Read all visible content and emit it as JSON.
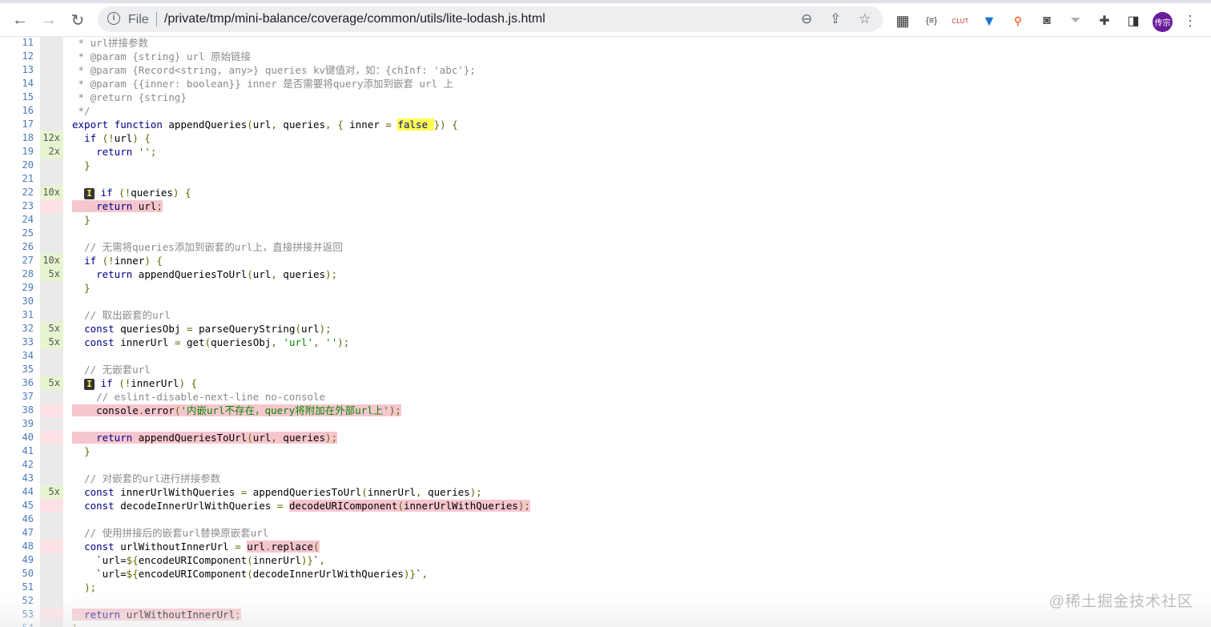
{
  "browser": {
    "scheme_label": "File",
    "url": "/private/tmp/mini-balance/coverage/common/utils/lite-lodash.js.html",
    "avatar_text": "传宗",
    "extensions": [
      "qr-code-icon",
      "json-viewer-icon",
      "clut-icon",
      "vue-devtools-icon",
      "sitemap-icon",
      "tampermonkey-icon",
      "filter-icon",
      "puzzle-icon",
      "side-panel-icon"
    ]
  },
  "watermark": "@稀土掘金技术社区",
  "lines": [
    {
      "n": "11",
      "hits": "",
      "cov": "neutral",
      "segs": [
        [
          "c",
          " * url拼接参数"
        ]
      ]
    },
    {
      "n": "12",
      "hits": "",
      "cov": "neutral",
      "segs": [
        [
          "c",
          " * @param {string} url 原始链接"
        ]
      ]
    },
    {
      "n": "13",
      "hits": "",
      "cov": "neutral",
      "segs": [
        [
          "c",
          " * @param {Record<string, any>} queries kv键值对，如：{chInf: 'abc'};"
        ]
      ]
    },
    {
      "n": "14",
      "hits": "",
      "cov": "neutral",
      "segs": [
        [
          "c",
          " * @param {{inner: boolean}} inner 是否需要将query添加到嵌套 url 上"
        ]
      ]
    },
    {
      "n": "15",
      "hits": "",
      "cov": "neutral",
      "segs": [
        [
          "c",
          " * @return {string}"
        ]
      ]
    },
    {
      "n": "16",
      "hits": "",
      "cov": "neutral",
      "segs": [
        [
          "c",
          " */"
        ]
      ]
    },
    {
      "n": "17",
      "hits": "",
      "cov": "neutral",
      "segs": [
        [
          "k",
          "export"
        ],
        [
          "p",
          " "
        ],
        [
          "k",
          "function"
        ],
        [
          "p",
          " appendQueries"
        ],
        [
          "n",
          "("
        ],
        [
          "p",
          "url"
        ],
        [
          "n",
          ","
        ],
        [
          "p",
          " queries"
        ],
        [
          "n",
          ","
        ],
        [
          "p",
          " "
        ],
        [
          "n",
          "{"
        ],
        [
          "p",
          " inner "
        ],
        [
          "n",
          "="
        ],
        [
          "p",
          " "
        ],
        [
          "k hl-yel",
          "false "
        ],
        [
          "n",
          "})"
        ],
        [
          "p",
          " "
        ],
        [
          "n",
          "{"
        ]
      ]
    },
    {
      "n": "18",
      "hits": "12x",
      "cov": "yes",
      "segs": [
        [
          "p",
          "  "
        ],
        [
          "k",
          "if"
        ],
        [
          "p",
          " "
        ],
        [
          "n",
          "(!"
        ],
        [
          "p",
          "url"
        ],
        [
          "n",
          ")"
        ],
        [
          "p",
          " "
        ],
        [
          "n",
          "{"
        ]
      ]
    },
    {
      "n": "19",
      "hits": "2x",
      "cov": "yes",
      "segs": [
        [
          "p",
          "    "
        ],
        [
          "k",
          "return"
        ],
        [
          "p",
          " "
        ],
        [
          "s",
          "''"
        ],
        [
          "n",
          ";"
        ]
      ]
    },
    {
      "n": "20",
      "hits": "",
      "cov": "neutral",
      "segs": [
        [
          "p",
          "  "
        ],
        [
          "n",
          "}"
        ]
      ]
    },
    {
      "n": "21",
      "hits": "",
      "cov": "neutral",
      "segs": []
    },
    {
      "n": "22",
      "hits": "10x",
      "cov": "yes",
      "segs": [
        [
          "p",
          "  "
        ],
        [
          "badge",
          "I"
        ],
        [
          "p",
          " "
        ],
        [
          "k",
          "if"
        ],
        [
          "p",
          " "
        ],
        [
          "n",
          "(!"
        ],
        [
          "p",
          "queries"
        ],
        [
          "n",
          ")"
        ],
        [
          "p",
          " "
        ],
        [
          "n",
          "{"
        ]
      ]
    },
    {
      "n": "23",
      "hits": "",
      "cov": "no",
      "segs": [
        [
          "k hl-no",
          "    return"
        ],
        [
          "p hl-no",
          " url"
        ],
        [
          "n hl-no",
          ";"
        ]
      ]
    },
    {
      "n": "24",
      "hits": "",
      "cov": "neutral",
      "segs": [
        [
          "p",
          "  "
        ],
        [
          "n",
          "}"
        ]
      ]
    },
    {
      "n": "25",
      "hits": "",
      "cov": "neutral",
      "segs": []
    },
    {
      "n": "26",
      "hits": "",
      "cov": "neutral",
      "segs": [
        [
          "p",
          "  "
        ],
        [
          "c",
          "// 无需将queries添加到嵌套的url上，直接拼接并返回"
        ]
      ]
    },
    {
      "n": "27",
      "hits": "10x",
      "cov": "yes",
      "segs": [
        [
          "p",
          "  "
        ],
        [
          "k",
          "if"
        ],
        [
          "p",
          " "
        ],
        [
          "n",
          "(!"
        ],
        [
          "p",
          "inner"
        ],
        [
          "n",
          ")"
        ],
        [
          "p",
          " "
        ],
        [
          "n",
          "{"
        ]
      ]
    },
    {
      "n": "28",
      "hits": "5x",
      "cov": "yes",
      "segs": [
        [
          "p",
          "    "
        ],
        [
          "k",
          "return"
        ],
        [
          "p",
          " appendQueriesToUrl"
        ],
        [
          "n",
          "("
        ],
        [
          "p",
          "url"
        ],
        [
          "n",
          ","
        ],
        [
          "p",
          " queries"
        ],
        [
          "n",
          ");"
        ]
      ]
    },
    {
      "n": "29",
      "hits": "",
      "cov": "neutral",
      "segs": [
        [
          "p",
          "  "
        ],
        [
          "n",
          "}"
        ]
      ]
    },
    {
      "n": "30",
      "hits": "",
      "cov": "neutral",
      "segs": []
    },
    {
      "n": "31",
      "hits": "",
      "cov": "neutral",
      "segs": [
        [
          "p",
          "  "
        ],
        [
          "c",
          "// 取出嵌套的url"
        ]
      ]
    },
    {
      "n": "32",
      "hits": "5x",
      "cov": "yes",
      "segs": [
        [
          "p",
          "  "
        ],
        [
          "k",
          "const"
        ],
        [
          "p",
          " queriesObj "
        ],
        [
          "n",
          "="
        ],
        [
          "p",
          " parseQueryString"
        ],
        [
          "n",
          "("
        ],
        [
          "p",
          "url"
        ],
        [
          "n",
          ");"
        ]
      ]
    },
    {
      "n": "33",
      "hits": "5x",
      "cov": "yes",
      "segs": [
        [
          "p",
          "  "
        ],
        [
          "k",
          "const"
        ],
        [
          "p",
          " innerUrl "
        ],
        [
          "n",
          "="
        ],
        [
          "p",
          " get"
        ],
        [
          "n",
          "("
        ],
        [
          "p",
          "queriesObj"
        ],
        [
          "n",
          ","
        ],
        [
          "p",
          " "
        ],
        [
          "s",
          "'url'"
        ],
        [
          "n",
          ","
        ],
        [
          "p",
          " "
        ],
        [
          "s",
          "''"
        ],
        [
          "n",
          ");"
        ]
      ]
    },
    {
      "n": "34",
      "hits": "",
      "cov": "neutral",
      "segs": []
    },
    {
      "n": "35",
      "hits": "",
      "cov": "neutral",
      "segs": [
        [
          "p",
          "  "
        ],
        [
          "c",
          "// 无嵌套url"
        ]
      ]
    },
    {
      "n": "36",
      "hits": "5x",
      "cov": "yes",
      "segs": [
        [
          "p",
          "  "
        ],
        [
          "badge",
          "I"
        ],
        [
          "p",
          " "
        ],
        [
          "k",
          "if"
        ],
        [
          "p",
          " "
        ],
        [
          "n",
          "(!"
        ],
        [
          "p",
          "innerUrl"
        ],
        [
          "n",
          ")"
        ],
        [
          "p",
          " "
        ],
        [
          "n",
          "{"
        ]
      ]
    },
    {
      "n": "37",
      "hits": "",
      "cov": "neutral",
      "segs": [
        [
          "p",
          "    "
        ],
        [
          "c",
          "// eslint-disable-next-line no-console"
        ]
      ]
    },
    {
      "n": "38",
      "hits": "",
      "cov": "no",
      "segs": [
        [
          "p hl-no",
          "    console"
        ],
        [
          "n hl-no",
          "."
        ],
        [
          "p hl-no",
          "error"
        ],
        [
          "n hl-no",
          "("
        ],
        [
          "s hl-no",
          "'内嵌url不存在，query将附加在外部url上'"
        ],
        [
          "n hl-no",
          ");"
        ]
      ]
    },
    {
      "n": "39",
      "hits": "",
      "cov": "neutral",
      "segs": []
    },
    {
      "n": "40",
      "hits": "",
      "cov": "no",
      "segs": [
        [
          "k hl-no",
          "    return"
        ],
        [
          "p hl-no",
          " appendQueriesToUrl"
        ],
        [
          "n hl-no",
          "("
        ],
        [
          "p hl-no",
          "url"
        ],
        [
          "n hl-no",
          ","
        ],
        [
          "p hl-no",
          " queries"
        ],
        [
          "n hl-no",
          ");"
        ]
      ]
    },
    {
      "n": "41",
      "hits": "",
      "cov": "neutral",
      "segs": [
        [
          "p",
          "  "
        ],
        [
          "n",
          "}"
        ]
      ]
    },
    {
      "n": "42",
      "hits": "",
      "cov": "neutral",
      "segs": []
    },
    {
      "n": "43",
      "hits": "",
      "cov": "neutral",
      "segs": [
        [
          "p",
          "  "
        ],
        [
          "c",
          "// 对嵌套的url进行拼接参数"
        ]
      ]
    },
    {
      "n": "44",
      "hits": "5x",
      "cov": "yes",
      "segs": [
        [
          "p",
          "  "
        ],
        [
          "k",
          "const"
        ],
        [
          "p",
          " innerUrlWithQueries "
        ],
        [
          "n",
          "="
        ],
        [
          "p",
          " appendQueriesToUrl"
        ],
        [
          "n",
          "("
        ],
        [
          "p",
          "innerUrl"
        ],
        [
          "n",
          ","
        ],
        [
          "p",
          " queries"
        ],
        [
          "n",
          ");"
        ]
      ]
    },
    {
      "n": "45",
      "hits": "",
      "cov": "no",
      "segs": [
        [
          "p",
          "  "
        ],
        [
          "k",
          "const"
        ],
        [
          "p",
          " decodeInnerUrlWithQueries "
        ],
        [
          "n",
          "="
        ],
        [
          "p",
          " "
        ],
        [
          "p hl-no",
          "decodeURIComponent"
        ],
        [
          "n hl-no",
          "("
        ],
        [
          "p hl-no",
          "innerUrlWithQueries"
        ],
        [
          "n hl-no",
          ");"
        ]
      ]
    },
    {
      "n": "46",
      "hits": "",
      "cov": "neutral",
      "segs": []
    },
    {
      "n": "47",
      "hits": "",
      "cov": "neutral",
      "segs": [
        [
          "p",
          "  "
        ],
        [
          "c",
          "// 使用拼接后的嵌套url替换原嵌套url"
        ]
      ]
    },
    {
      "n": "48",
      "hits": "",
      "cov": "no",
      "segs": [
        [
          "p",
          "  "
        ],
        [
          "k",
          "const"
        ],
        [
          "p",
          " urlWithoutInnerUrl "
        ],
        [
          "n",
          "="
        ],
        [
          "p",
          " "
        ],
        [
          "p hl-no",
          "url"
        ],
        [
          "n hl-no",
          "."
        ],
        [
          "p hl-no",
          "replace"
        ],
        [
          "n hl-no",
          "("
        ]
      ]
    },
    {
      "n": "49",
      "hits": "",
      "cov": "neutral",
      "segs": [
        [
          "p",
          "    `url="
        ],
        [
          "n",
          "${"
        ],
        [
          "p",
          "encodeURIComponent"
        ],
        [
          "n",
          "("
        ],
        [
          "p",
          "innerUrl"
        ],
        [
          "n",
          ")}"
        ],
        [
          "p",
          "`"
        ],
        [
          "n",
          ","
        ]
      ]
    },
    {
      "n": "50",
      "hits": "",
      "cov": "neutral",
      "segs": [
        [
          "p",
          "    `url="
        ],
        [
          "n",
          "${"
        ],
        [
          "p",
          "encodeURIComponent"
        ],
        [
          "n",
          "("
        ],
        [
          "p",
          "decodeInnerUrlWithQueries"
        ],
        [
          "n",
          ")}"
        ],
        [
          "p",
          "`"
        ],
        [
          "n",
          ","
        ]
      ]
    },
    {
      "n": "51",
      "hits": "",
      "cov": "neutral",
      "segs": [
        [
          "p",
          "  "
        ],
        [
          "n",
          ");"
        ]
      ]
    },
    {
      "n": "52",
      "hits": "",
      "cov": "neutral",
      "segs": []
    },
    {
      "n": "53",
      "hits": "",
      "cov": "no",
      "segs": [
        [
          "k hl-no",
          "  return"
        ],
        [
          "p hl-no",
          " urlWithoutInnerUrl"
        ],
        [
          "n hl-no",
          ";"
        ]
      ]
    },
    {
      "n": "54",
      "hits": "",
      "cov": "neutral",
      "segs": [
        [
          "n",
          "}"
        ]
      ]
    }
  ]
}
